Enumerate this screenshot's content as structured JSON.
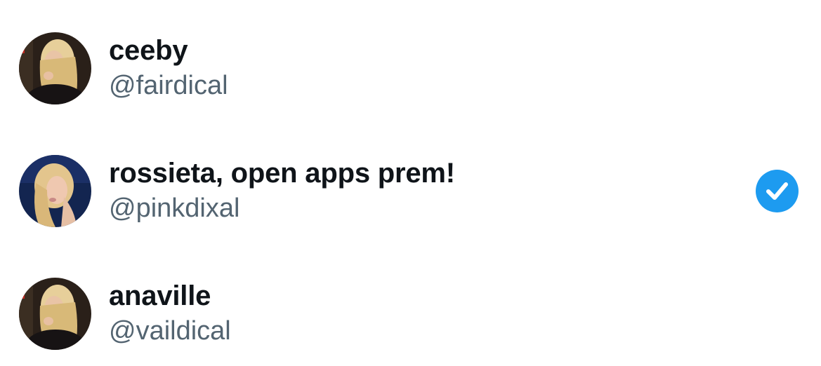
{
  "accounts": [
    {
      "display_name": "ceeby",
      "handle": "@fairdical",
      "avatar": "user-photo-icon",
      "selected": false
    },
    {
      "display_name": "rossieta, open apps prem!",
      "handle": "@pinkdixal",
      "avatar": "user-photo-icon",
      "selected": true
    },
    {
      "display_name": "anaville",
      "handle": "@vaildical",
      "avatar": "user-photo-icon",
      "selected": false
    }
  ],
  "colors": {
    "name": "#0f1419",
    "handle": "#536471",
    "selected_badge": "#1d9bf0",
    "background": "#ffffff"
  },
  "icons": {
    "selected": "checkmark-circle-icon"
  }
}
